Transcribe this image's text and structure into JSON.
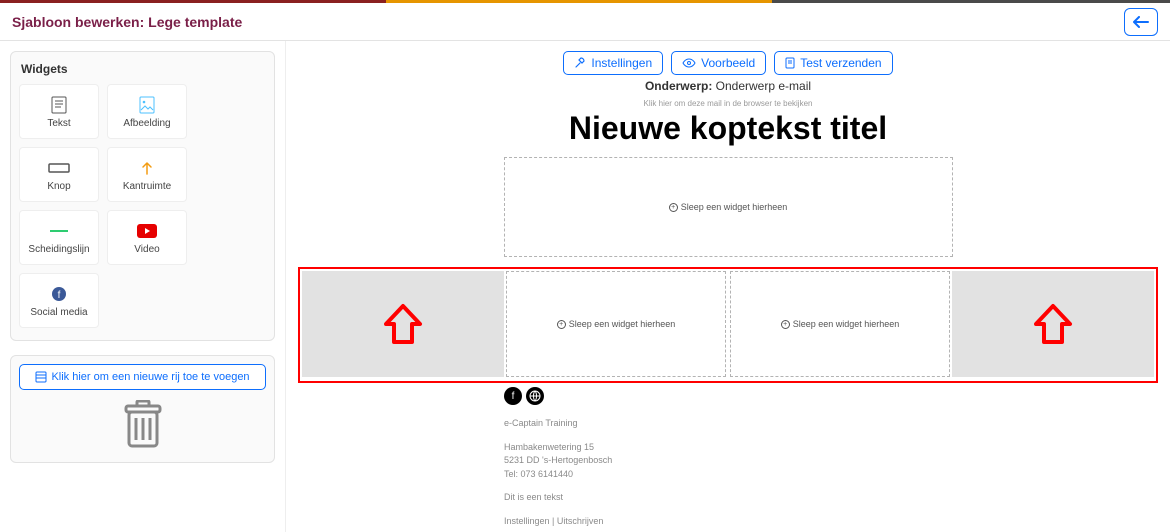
{
  "header": {
    "title": "Sjabloon bewerken: Lege template"
  },
  "sidebar": {
    "panel_title": "Widgets",
    "widgets": [
      {
        "icon": "text",
        "label": "Tekst",
        "color": "#555"
      },
      {
        "icon": "image",
        "label": "Afbeelding",
        "color": "#4cc1ff"
      },
      {
        "icon": "button",
        "label": "Knop",
        "color": "#555"
      },
      {
        "icon": "margin",
        "label": "Kantruimte",
        "color": "#f39c12"
      },
      {
        "icon": "divider",
        "label": "Scheidingslijn",
        "color": "#2ecc71"
      },
      {
        "icon": "video",
        "label": "Video",
        "color": "#e60000"
      },
      {
        "icon": "social",
        "label": "Social media",
        "color": "#3b5998"
      }
    ],
    "add_row_label": "Klik hier om een nieuwe rij toe te voegen"
  },
  "toolbar": {
    "settings": "Instellingen",
    "preview": "Voorbeeld",
    "send_test": "Test verzenden"
  },
  "subject": {
    "label": "Onderwerp:",
    "value": "Onderwerp e-mail"
  },
  "canvas": {
    "browser_hint": "Klik hier om deze mail in de browser te bekijken",
    "heading": "Nieuwe koptekst titel",
    "drop_hint": "Sleep een widget hierheen"
  },
  "footer": {
    "org": "e-Captain Training",
    "addr1": "Hambakenwetering 15",
    "addr2": "5231 DD 's-Hertogenbosch",
    "tel": "Tel: 073 6141440",
    "note": "Dit is een tekst",
    "links": "Instellingen | Uitschrijven"
  }
}
